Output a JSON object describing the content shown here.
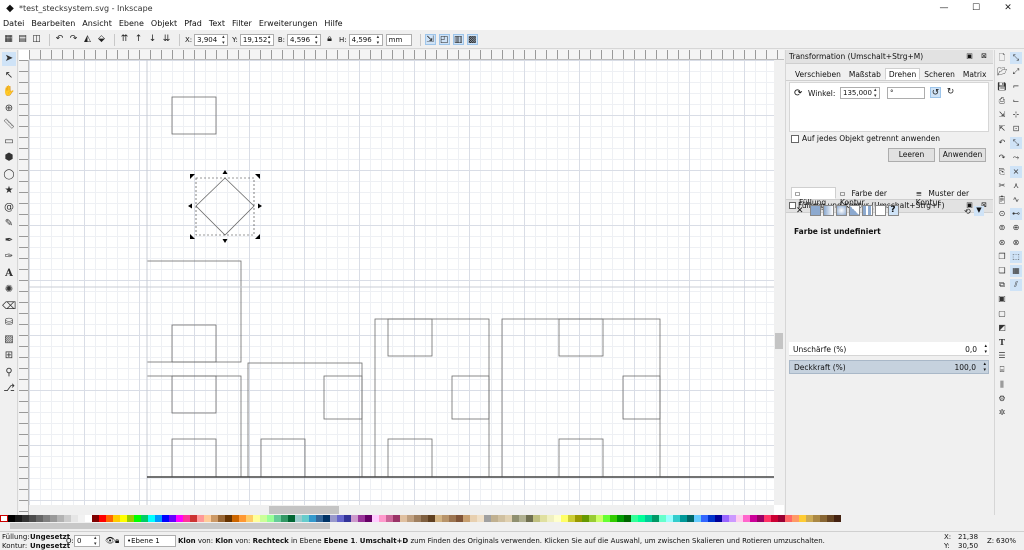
{
  "window": {
    "title": "*test_stecksystem.svg - Inkscape",
    "minimize": "—",
    "maximize": "☐",
    "close": "✕"
  },
  "menu": [
    "Datei",
    "Bearbeiten",
    "Ansicht",
    "Ebene",
    "Objekt",
    "Pfad",
    "Text",
    "Filter",
    "Erweiterungen",
    "Hilfe"
  ],
  "controls": {
    "x_label": "X:",
    "x_value": "3,904",
    "y_label": "Y:",
    "y_value": "19,152",
    "w_label": "B:",
    "w_value": "4,596",
    "h_label": "H:",
    "h_value": "4,596",
    "unit": "mm"
  },
  "transform_dialog": {
    "title": "Transformation (Umschalt+Strg+M)",
    "tabs": [
      "Verschieben",
      "Maßstab",
      "Drehen",
      "Scheren",
      "Matrix"
    ],
    "active_tab": "Drehen",
    "angle_label": "Winkel:",
    "angle_value": "135,000",
    "angle_unit": "°",
    "checkbox_label": "Auf jedes Objekt getrennt anwenden",
    "clear_button": "Leeren",
    "apply_button": "Anwenden"
  },
  "fill_dialog": {
    "title": "Füllung und Kontur (Umschalt+Strg+F)",
    "tabs": [
      "Füllung",
      "Farbe der Kontur",
      "Muster der Kontur"
    ],
    "undefined_text": "Farbe ist undefiniert",
    "blur_label": "Unschärfe (%)",
    "blur_value": "0,0",
    "opacity_label": "Deckkraft (%)",
    "opacity_value": "100,0"
  },
  "status": {
    "fill_label": "Füllung:",
    "fill_value": "Ungesetzt",
    "stroke_label": "Kontur:",
    "stroke_value": "Ungesetzt",
    "opacity_label": "O:",
    "opacity_value": "0",
    "layer": "•Ebene 1",
    "message_parts": [
      {
        "b": true,
        "t": "Klon"
      },
      {
        "b": false,
        "t": " von: "
      },
      {
        "b": true,
        "t": "Klon"
      },
      {
        "b": false,
        "t": " von: "
      },
      {
        "b": true,
        "t": "Rechteck"
      },
      {
        "b": false,
        "t": " in Ebene "
      },
      {
        "b": true,
        "t": "Ebene 1"
      },
      {
        "b": false,
        "t": ". "
      },
      {
        "b": true,
        "t": "Umschalt+D"
      },
      {
        "b": false,
        "t": " zum Finden des Originals verwenden. Klicken Sie auf die Auswahl, um zwischen Skalieren und Rotieren umzuschalten."
      }
    ],
    "x_label": "X:",
    "x_coord": "21,38",
    "y_label": "Y:",
    "y_coord": "30,50",
    "zoom_label": "Z:",
    "zoom": "630%"
  },
  "colors": {
    "accent": "#cfe3f7",
    "canvas": "#ffffff",
    "chrome": "#f0f0f0"
  },
  "palette": [
    "#000000",
    "#1a1a1a",
    "#333333",
    "#4d4d4d",
    "#666666",
    "#808080",
    "#999999",
    "#b3b3b3",
    "#cccccc",
    "#e6e6e6",
    "#f2f2f2",
    "#ffffff",
    "#800000",
    "#ff0000",
    "#ff6600",
    "#ffcc00",
    "#ffff00",
    "#99cc00",
    "#00ff00",
    "#00cc66",
    "#00ffff",
    "#0099ff",
    "#0000ff",
    "#6600ff",
    "#ff00ff",
    "#ff3399",
    "#cc3333",
    "#ff9999",
    "#ffcc99",
    "#cc9966",
    "#996633",
    "#663300",
    "#cc6600",
    "#ff9933",
    "#ffcc66",
    "#ffff99",
    "#ccff99",
    "#99ff99",
    "#66cc99",
    "#339966",
    "#006633",
    "#99cccc",
    "#66cccc",
    "#3399cc",
    "#336699",
    "#003366",
    "#9999cc",
    "#6666cc",
    "#333399",
    "#cc99cc",
    "#993399",
    "#660066",
    "#ffccff",
    "#ff99cc",
    "#cc6699",
    "#993366",
    "#e0c0a0",
    "#c0a080",
    "#a08060",
    "#806040",
    "#604020",
    "#d4b483",
    "#b8946a",
    "#9c7450",
    "#805437",
    "#c8a070",
    "#e8d0b0",
    "#f0e0c8",
    "#a0a0a0",
    "#c0b090",
    "#d0c0a0",
    "#e0d0b0",
    "#909070",
    "#b0b090",
    "#707050",
    "#c0c080",
    "#e0e0a0",
    "#f0f0c0",
    "#ffffcc",
    "#ffff66",
    "#cccc33",
    "#999900",
    "#669900",
    "#99cc33",
    "#ccff66",
    "#66ff33",
    "#33cc00",
    "#009900",
    "#006600",
    "#33ff99",
    "#00ff99",
    "#00cc99",
    "#009966",
    "#66ffcc",
    "#99ffff",
    "#33cccc",
    "#009999",
    "#006666",
    "#66ccff",
    "#3366ff",
    "#0033cc",
    "#000099",
    "#9966ff",
    "#cc99ff",
    "#ffccee",
    "#ff66cc",
    "#cc0099",
    "#990066",
    "#ff3366",
    "#cc0033",
    "#990033",
    "#ff6666",
    "#ff9966",
    "#ffcc33",
    "#ccaa55",
    "#aa8844",
    "#886633",
    "#664422",
    "#442211"
  ]
}
